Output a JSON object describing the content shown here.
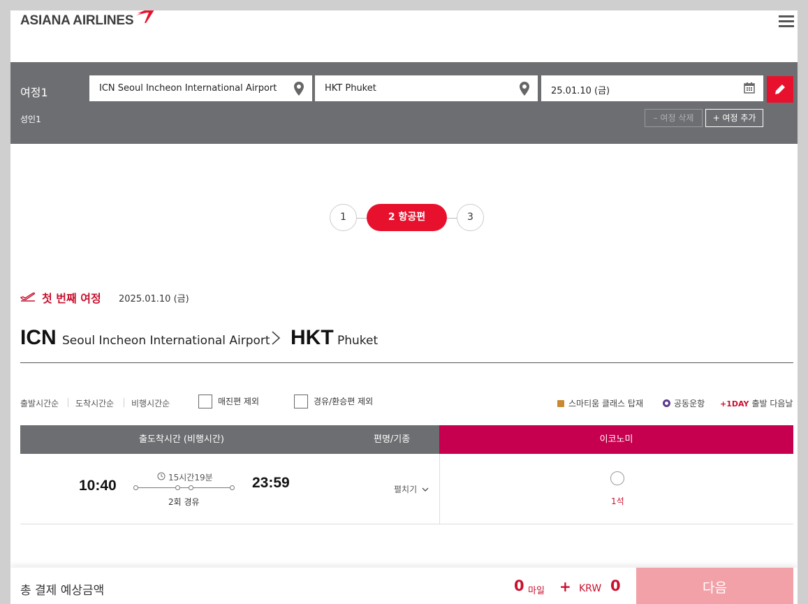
{
  "header": {
    "logo_text": "ASIANA AIRLINES",
    "brand_color": "#e8112d",
    "menu_icon": "hamburger-icon"
  },
  "itinerary": {
    "label": "여정1",
    "passengers": "성인1",
    "origin": "ICN Seoul Incheon International Airport",
    "destination": "HKT Phuket",
    "date": "25.01.10 (금)",
    "delete_label": "– 여정 삭제",
    "add_label": "+ 여정 추가"
  },
  "steps": {
    "step1": "1",
    "step2": "2  항공편",
    "step3": "3"
  },
  "journey": {
    "title": "첫 번째 여정",
    "date": "2025.01.10 (금)",
    "origin_code": "ICN",
    "origin_city": "Seoul Incheon International Airport",
    "dest_code": "HKT",
    "dest_city": "Phuket"
  },
  "filters": {
    "sort_departure": "출발시간순",
    "sort_arrival": "도착시간순",
    "sort_duration": "비행시간순",
    "exclude_soldout": "매진편 제외",
    "exclude_transfer": "경유/환승편 제외",
    "legend_smartium": "스마티움 클래스 탑재",
    "legend_codeshare": "공동운항",
    "legend_plusday_tag": "+1DAY",
    "legend_plusday": "출발 다음날"
  },
  "table": {
    "col_time": "출도착시간 (비행시간)",
    "col_flight": "편명/기종",
    "col_economy": "이코노미",
    "rows": [
      {
        "departure": "10:40",
        "arrival": "23:59",
        "duration": "15시간19분",
        "stops": "2회 경유",
        "expand": "펼치기",
        "seats": "1석"
      }
    ]
  },
  "footer": {
    "total_label": "총 결제 예상금액",
    "miles": "0",
    "miles_unit": "마일",
    "plus": "+",
    "currency": "KRW",
    "amount": "0",
    "next_label": "다음"
  }
}
